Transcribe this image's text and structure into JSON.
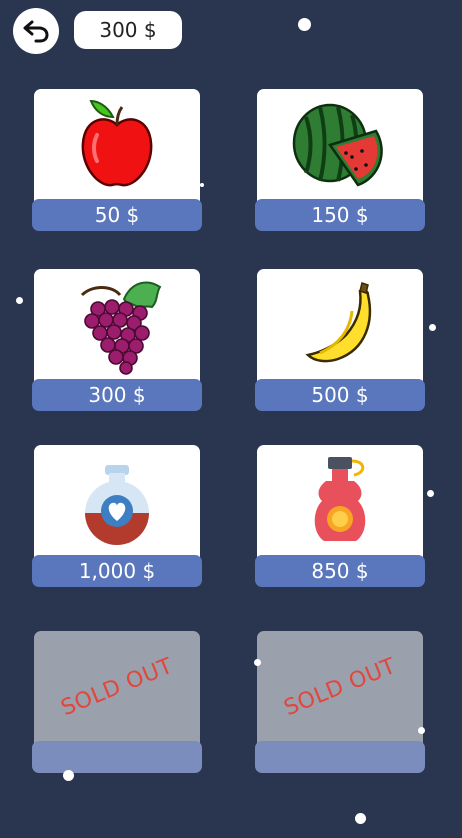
{
  "header": {
    "back_icon": "back-arrow-icon",
    "balance": "300 $"
  },
  "shop": {
    "items": [
      {
        "icon": "apple-icon",
        "price": "50 $"
      },
      {
        "icon": "watermelon-icon",
        "price": "150 $"
      },
      {
        "icon": "grapes-icon",
        "price": "300 $"
      },
      {
        "icon": "banana-icon",
        "price": "500 $"
      },
      {
        "icon": "heart-potion-icon",
        "price": "1,000 $"
      },
      {
        "icon": "perfume-bottle-icon",
        "price": "850 $"
      }
    ],
    "sold_out": [
      {
        "label": "SOLD OUT"
      },
      {
        "label": "SOLD OUT"
      }
    ]
  },
  "colors": {
    "background": "#2a3650",
    "price_bar": "#5a77bd",
    "sold_out_card": "#9aa1ad",
    "sold_out_text": "#e2463c"
  }
}
